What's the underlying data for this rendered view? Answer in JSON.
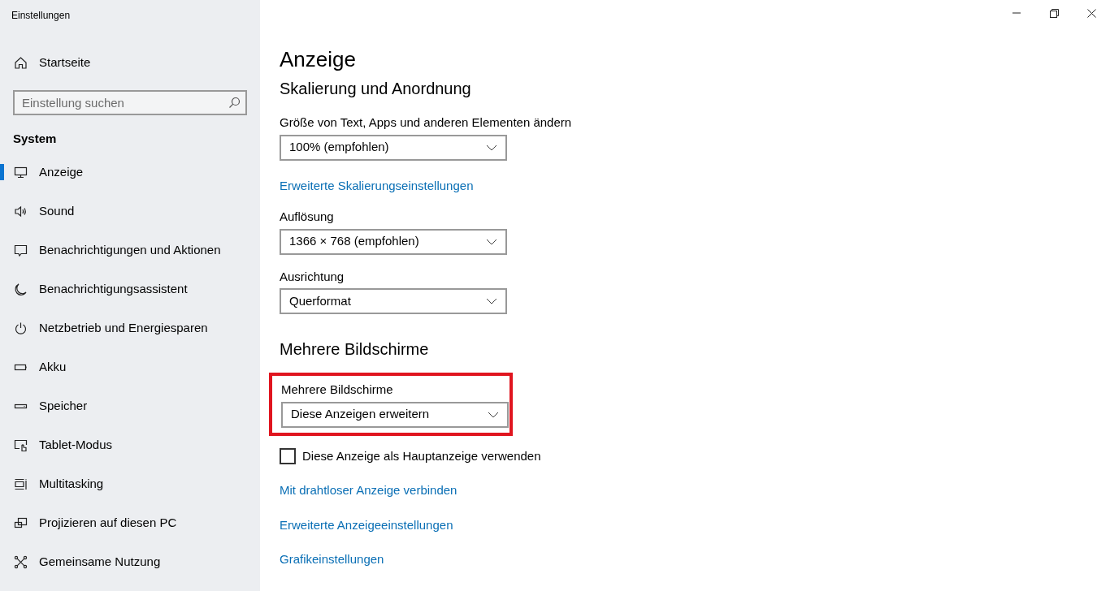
{
  "window": {
    "title": "Einstellungen"
  },
  "sidebar": {
    "home": "Startseite",
    "search": {
      "placeholder": "Einstellung suchen"
    },
    "section": "System",
    "items": [
      {
        "label": "Anzeige",
        "selected": true
      },
      {
        "label": "Sound",
        "selected": false
      },
      {
        "label": "Benachrichtigungen und Aktionen",
        "selected": false
      },
      {
        "label": "Benachrichtigungsassistent",
        "selected": false
      },
      {
        "label": "Netzbetrieb und Energiesparen",
        "selected": false
      },
      {
        "label": "Akku",
        "selected": false
      },
      {
        "label": "Speicher",
        "selected": false
      },
      {
        "label": "Tablet-Modus",
        "selected": false
      },
      {
        "label": "Multitasking",
        "selected": false
      },
      {
        "label": "Projizieren auf diesen PC",
        "selected": false
      },
      {
        "label": "Gemeinsame Nutzung",
        "selected": false
      }
    ]
  },
  "main": {
    "title": "Anzeige",
    "sections": [
      {
        "heading": "Skalierung und Anordnung",
        "controls": [
          {
            "kind": "dropdown",
            "label": "Größe von Text, Apps und anderen Elementen ändern",
            "value": "100% (empfohlen)",
            "highlighted": false
          },
          {
            "kind": "link",
            "text": "Erweiterte Skalierungseinstellungen"
          },
          {
            "kind": "dropdown",
            "label": "Auflösung",
            "value": "1366 × 768 (empfohlen)",
            "highlighted": false
          },
          {
            "kind": "dropdown",
            "label": "Ausrichtung",
            "value": "Querformat",
            "highlighted": false
          }
        ]
      },
      {
        "heading": "Mehrere Bildschirme",
        "controls": [
          {
            "kind": "dropdown",
            "label": "Mehrere Bildschirme",
            "value": "Diese Anzeigen erweitern",
            "highlighted": true
          },
          {
            "kind": "checkbox",
            "text": "Diese Anzeige als Hauptanzeige verwenden",
            "checked": false
          },
          {
            "kind": "link",
            "text": "Mit drahtloser Anzeige verbinden"
          },
          {
            "kind": "link",
            "text": "Erweiterte Anzeigeeinstellungen"
          },
          {
            "kind": "link",
            "text": "Grafikeinstellungen"
          }
        ]
      }
    ]
  }
}
